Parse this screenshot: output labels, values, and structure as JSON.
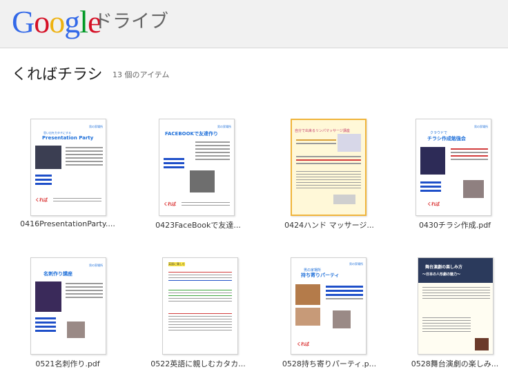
{
  "header": {
    "logo_letters": [
      {
        "ch": "G",
        "color": "#3369e8"
      },
      {
        "ch": "o",
        "color": "#d50f25"
      },
      {
        "ch": "o",
        "color": "#eeb211"
      },
      {
        "ch": "g",
        "color": "#3369e8"
      },
      {
        "ch": "l",
        "color": "#009925"
      },
      {
        "ch": "e",
        "color": "#d50f25"
      }
    ],
    "product_name": "ドライブ"
  },
  "folder": {
    "title": "くればチラシ",
    "item_count": "13 個のアイテム"
  },
  "files": [
    {
      "name": "0416PresentationParty....",
      "thumb": {
        "head": "Presentation Party",
        "top": "思い出を力タチにする",
        "corner": "男の家場所"
      }
    },
    {
      "name": "0423FaceBookで友達...",
      "thumb": {
        "head": "FACEBOOKで友達作り",
        "corner": "男の家場所"
      }
    },
    {
      "name": "0424ハンド マッサージ...",
      "thumb": {
        "head": "自分で出来るリンパマッサージ講座"
      }
    },
    {
      "name": "0430チラシ作成.pdf",
      "thumb": {
        "head": "チラシ作成勉強会",
        "top": "クラウドで",
        "corner": "男の家場所"
      }
    },
    {
      "name": "0521名刺作り.pdf",
      "thumb": {
        "head": "名刺作り講座",
        "corner": "男の家場所"
      }
    },
    {
      "name": "0522英語に親しむカタカ...",
      "thumb": {
        "head": "英語に親しむ"
      }
    },
    {
      "name": "0528持ち寄りパーティ.p...",
      "thumb": {
        "head": "持ち寄りパーティ",
        "top": "男の家場所",
        "corner": "男の家場所"
      }
    },
    {
      "name": "0528舞台演劇の楽しみ...",
      "thumb": {
        "head": "舞台演劇の楽しみ方",
        "sub": "～日本の人形劇の魅力～"
      }
    }
  ]
}
